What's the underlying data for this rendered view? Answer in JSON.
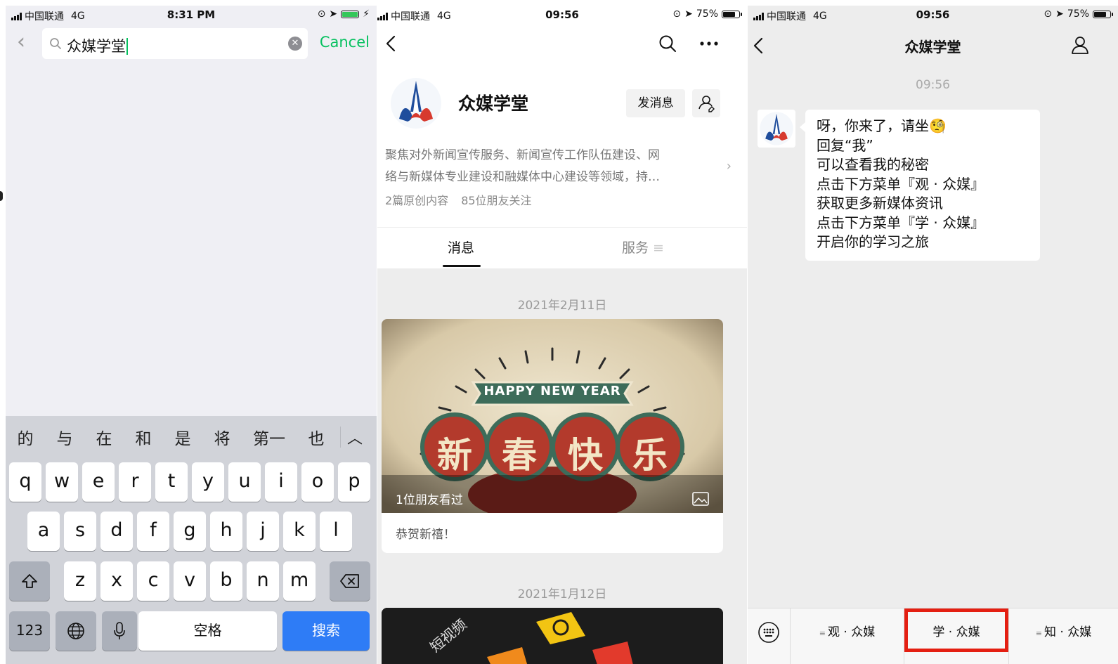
{
  "panel1": {
    "status": {
      "carrier": "中国联通",
      "network": "4G",
      "time": "8:31 PM"
    },
    "search": {
      "value": "众媒学堂",
      "cancel_label": "Cancel"
    },
    "keyboard": {
      "candidates": [
        "的",
        "与",
        "在",
        "和",
        "是",
        "将",
        "第一",
        "也"
      ],
      "collapse_glyph": "︿",
      "row1": [
        "q",
        "w",
        "e",
        "r",
        "t",
        "y",
        "u",
        "i",
        "o",
        "p"
      ],
      "row2": [
        "a",
        "s",
        "d",
        "f",
        "g",
        "h",
        "j",
        "k",
        "l"
      ],
      "row3": [
        "z",
        "x",
        "c",
        "v",
        "b",
        "n",
        "m"
      ],
      "num_label": "123",
      "space_label": "空格",
      "search_label": "搜索"
    }
  },
  "panel2": {
    "status": {
      "carrier": "中国联通",
      "network": "4G",
      "time": "09:56",
      "battery": "75%"
    },
    "account": {
      "name": "众媒学堂",
      "send_message": "发消息",
      "description_line1": "聚焦对外新闻宣传服务、新闻宣传工作队伍建设、网",
      "description_line2": "络与新媒体专业建设和融媒体中心建设等领域，持…",
      "original_count": "2篇原创内容",
      "friends_follow": "85位朋友关注"
    },
    "tabs": {
      "messages": "消息",
      "services": "服务"
    },
    "posts": [
      {
        "date": "2021年2月11日",
        "banner": "HAPPY NEW YEAR",
        "chars": [
          "新",
          "春",
          "快",
          "乐"
        ],
        "viewed": "1位朋友看过",
        "caption": "恭贺新禧！"
      },
      {
        "date": "2021年1月12日",
        "image_text": "短视频"
      }
    ]
  },
  "panel3": {
    "status": {
      "carrier": "中国联通",
      "network": "4G",
      "time": "09:56",
      "battery": "75%"
    },
    "title": "众媒学堂",
    "chat_time": "09:56",
    "message_lines": [
      "呀，你来了，请坐🧐",
      "回复“我”",
      "可以查看我的秘密",
      "点击下方菜单『观 · 众媒』",
      "获取更多新媒体资讯",
      "点击下方菜单『学 · 众媒』",
      "开启你的学习之旅"
    ],
    "menu": [
      "观 · 众媒",
      "学 · 众媒",
      "知 · 众媒"
    ],
    "highlight_color": "#e41f12"
  },
  "colors": {
    "wechat_green": "#07c160",
    "ios_blue": "#2e7cf6"
  }
}
